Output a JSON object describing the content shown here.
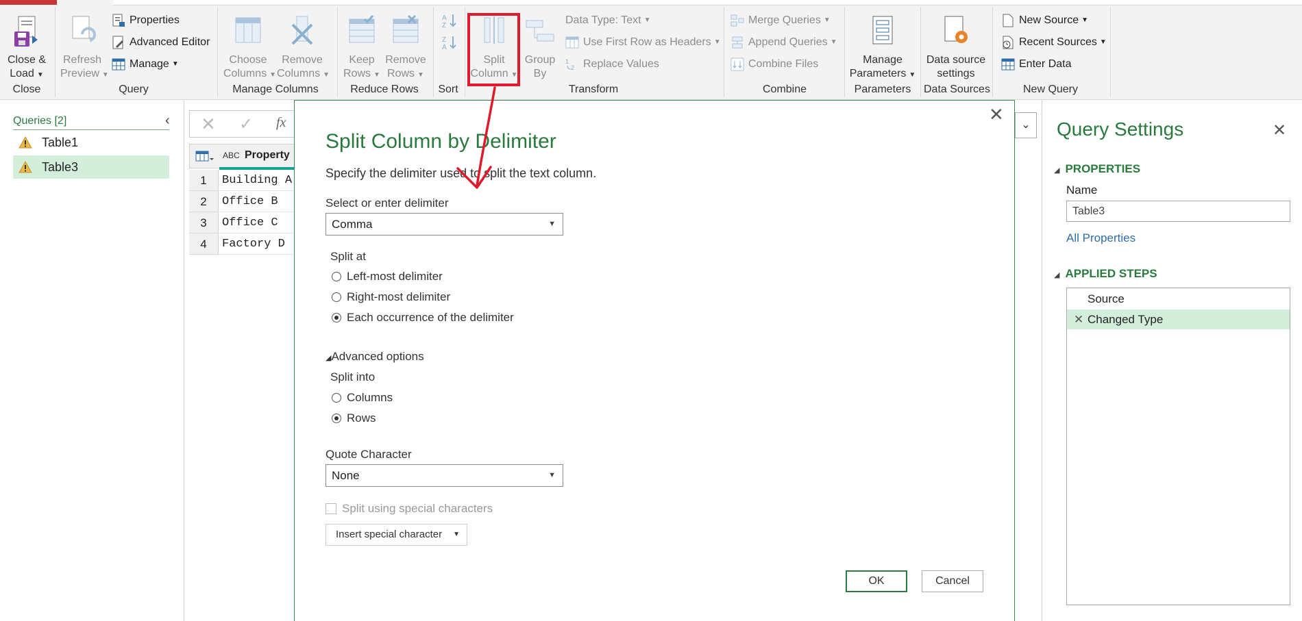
{
  "ribbon": {
    "close_group": {
      "label": "Close",
      "close_load": "Close &",
      "close_load2": "Load"
    },
    "query_group": {
      "label": "Query",
      "refresh": "Refresh",
      "refresh2": "Preview",
      "properties": "Properties",
      "advanced_editor": "Advanced Editor",
      "manage": "Manage"
    },
    "manage_columns_group": {
      "label": "Manage Columns",
      "choose": "Choose",
      "choose2": "Columns",
      "remove": "Remove",
      "remove2": "Columns"
    },
    "reduce_rows_group": {
      "label": "Reduce Rows",
      "keep": "Keep",
      "keep2": "Rows",
      "remove": "Remove",
      "remove2": "Rows"
    },
    "sort_group": {
      "label": "Sort"
    },
    "transform_group": {
      "label": "Transform",
      "split": "Split",
      "split2": "Column",
      "group": "Group",
      "group2": "By",
      "data_type": "Data Type: Text",
      "first_row": "Use First Row as Headers",
      "replace": "Replace Values"
    },
    "combine_group": {
      "label": "Combine",
      "merge": "Merge Queries",
      "append": "Append Queries",
      "combine_files": "Combine Files"
    },
    "parameters_group": {
      "label": "Parameters",
      "manage": "Manage",
      "manage2": "Parameters"
    },
    "data_sources_group": {
      "label": "Data Sources",
      "settings": "Data source",
      "settings2": "settings"
    },
    "new_query_group": {
      "label": "New Query",
      "new_source": "New Source",
      "recent_sources": "Recent Sources",
      "enter_data": "Enter Data"
    }
  },
  "queries": {
    "title": "Queries [2]",
    "items": [
      {
        "label": "Table1"
      },
      {
        "label": "Table3"
      }
    ]
  },
  "grid": {
    "column_header": "Property",
    "type_label": "ABC",
    "rows": [
      {
        "num": "1",
        "value": "Building A"
      },
      {
        "num": "2",
        "value": "Office B"
      },
      {
        "num": "3",
        "value": "Office C"
      },
      {
        "num": "4",
        "value": "Factory D"
      }
    ]
  },
  "dialog": {
    "title": "Split Column by Delimiter",
    "subtitle": "Specify the delimiter used to split the text column.",
    "delimiter_label": "Select or enter delimiter",
    "delimiter_value": "Comma",
    "split_at_label": "Split at",
    "split_at_options": [
      "Left-most delimiter",
      "Right-most delimiter",
      "Each occurrence of the delimiter"
    ],
    "advanced_label": "Advanced options",
    "split_into_label": "Split into",
    "split_into_options": [
      "Columns",
      "Rows"
    ],
    "quote_label": "Quote Character",
    "quote_value": "None",
    "special_chars_label": "Split using special characters",
    "insert_special_label": "Insert special character",
    "ok_label": "OK",
    "cancel_label": "Cancel"
  },
  "settings": {
    "title": "Query Settings",
    "properties_title": "PROPERTIES",
    "name_label": "Name",
    "name_value": "Table3",
    "all_properties": "All Properties",
    "applied_steps_title": "APPLIED STEPS",
    "steps": [
      {
        "label": "Source"
      },
      {
        "label": "Changed Type"
      }
    ]
  },
  "colors": {
    "accent_green": "#2a7a3d",
    "highlight_red": "#e11a2b",
    "selection_bg": "#d4eedc"
  }
}
